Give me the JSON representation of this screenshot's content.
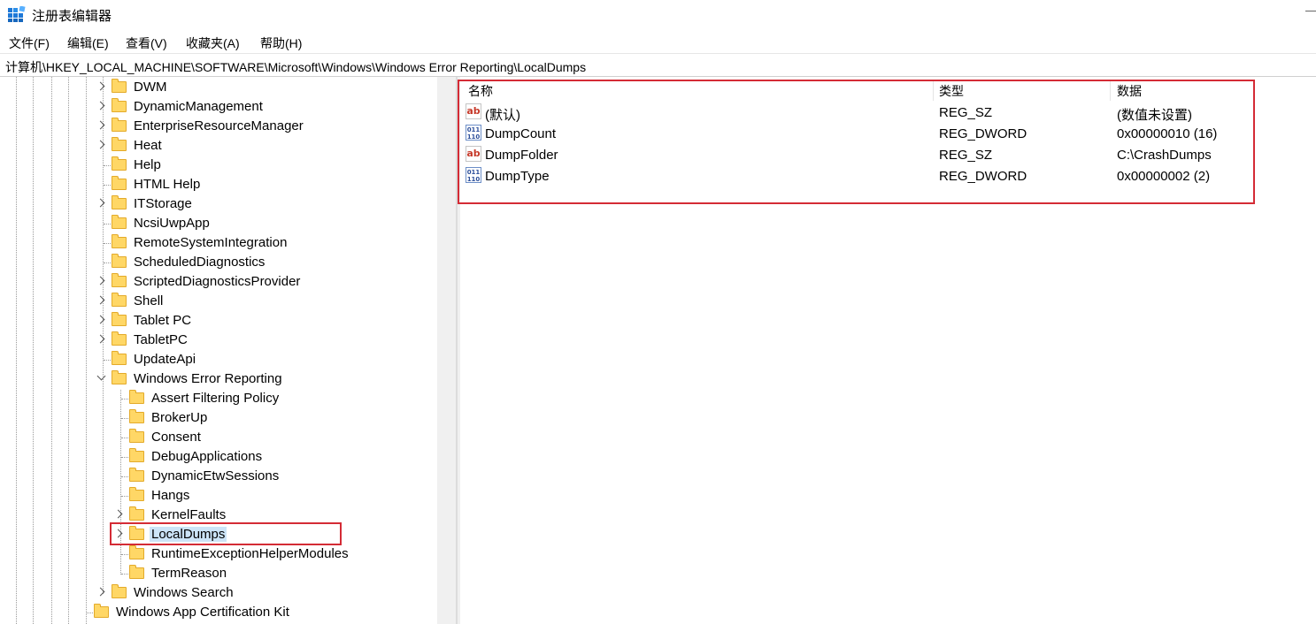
{
  "window": {
    "title": "注册表编辑器",
    "app_icon": "registry-editor-icon"
  },
  "menu": [
    "文件(F)",
    "编辑(E)",
    "查看(V)",
    "收藏夹(A)",
    "帮助(H)"
  ],
  "address": "计算机\\HKEY_LOCAL_MACHINE\\SOFTWARE\\Microsoft\\Windows\\Windows Error Reporting\\LocalDumps",
  "tree": {
    "items": [
      {
        "label": "DWM",
        "expandable": true
      },
      {
        "label": "DynamicManagement",
        "expandable": true
      },
      {
        "label": "EnterpriseResourceManager",
        "expandable": true
      },
      {
        "label": "Heat",
        "expandable": true
      },
      {
        "label": "Help",
        "expandable": false
      },
      {
        "label": "HTML Help",
        "expandable": false
      },
      {
        "label": "ITStorage",
        "expandable": true
      },
      {
        "label": "NcsiUwpApp",
        "expandable": false
      },
      {
        "label": "RemoteSystemIntegration",
        "expandable": false
      },
      {
        "label": "ScheduledDiagnostics",
        "expandable": false
      },
      {
        "label": "ScriptedDiagnosticsProvider",
        "expandable": true
      },
      {
        "label": "Shell",
        "expandable": true
      },
      {
        "label": "Tablet PC",
        "expandable": true
      },
      {
        "label": "TabletPC",
        "expandable": true
      },
      {
        "label": "UpdateApi",
        "expandable": false
      },
      {
        "label": "Windows Error Reporting",
        "expanded": true
      },
      {
        "label": "Assert Filtering Policy",
        "expandable": false
      },
      {
        "label": "BrokerUp",
        "expandable": false
      },
      {
        "label": "Consent",
        "expandable": false
      },
      {
        "label": "DebugApplications",
        "expandable": false
      },
      {
        "label": "DynamicEtwSessions",
        "expandable": false
      },
      {
        "label": "Hangs",
        "expandable": false
      },
      {
        "label": "KernelFaults",
        "expandable": true
      },
      {
        "label": "LocalDumps",
        "expandable": true,
        "selected": true
      },
      {
        "label": "RuntimeExceptionHelperModules",
        "expandable": false
      },
      {
        "label": "TermReason",
        "expandable": false
      },
      {
        "label": "Windows Search",
        "expandable": true
      },
      {
        "label": "Windows App Certification Kit",
        "expandable": false
      }
    ]
  },
  "values_list": {
    "columns": [
      "名称",
      "类型",
      "数据"
    ],
    "rows": [
      {
        "icon": "string-value-icon",
        "name": "(默认)",
        "type": "REG_SZ",
        "data": "(数值未设置)"
      },
      {
        "icon": "dword-value-icon",
        "name": "DumpCount",
        "type": "REG_DWORD",
        "data": "0x00000010 (16)"
      },
      {
        "icon": "string-value-icon",
        "name": "DumpFolder",
        "type": "REG_SZ",
        "data": "C:\\CrashDumps"
      },
      {
        "icon": "dword-value-icon",
        "name": "DumpType",
        "type": "REG_DWORD",
        "data": "0x00000002 (2)"
      }
    ]
  },
  "icon_glyphs": {
    "string": "ab",
    "binary": "011\n110"
  },
  "highlight_color": "#d42b35",
  "selection_color": "#cce4f7",
  "folder_color": "#ffd766"
}
